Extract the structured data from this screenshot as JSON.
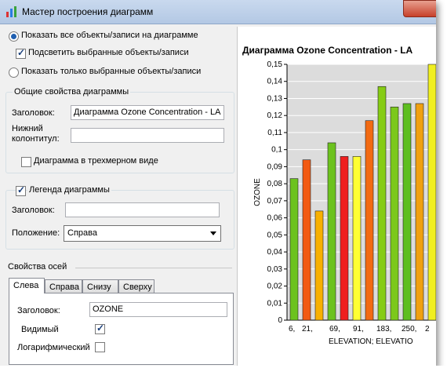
{
  "window": {
    "title": "Мастер построения диаграмм"
  },
  "display": {
    "show_all_label": "Показать все объекты/записи на диаграмме",
    "highlight_selected_label": "Подсветить выбранные объекты/записи",
    "show_selected_only_label": "Показать только выбранные объекты/записи"
  },
  "general": {
    "group_title": "Общие свойства диаграммы",
    "title_label": "Заголовок:",
    "title_value": "Диаграмма  Ozone Concentration - LA",
    "footer_label_1": "Нижний",
    "footer_label_2": "колонтитул:",
    "footer_value": "",
    "three_d_label": "Диаграмма в трехмерном виде"
  },
  "legend": {
    "group_title": "Легенда диаграммы",
    "title_label": "Заголовок:",
    "title_value": "",
    "position_label": "Положение:",
    "position_value": "Справа"
  },
  "axes": {
    "section_title": "Свойства осей",
    "tabs": [
      "Слева",
      "Справа",
      "Снизу",
      "Сверху"
    ],
    "title_label": "Заголовок:",
    "title_value": "OZONE",
    "visible_label": "Видимый",
    "log_label": "Логарифмический"
  },
  "chart_data": {
    "type": "bar",
    "title": "Диаграмма  Ozone Concentration - LA",
    "xlabel": "ELEVATION; ELEVATIO",
    "ylabel": "OZONE",
    "ylim": [
      0,
      0.15
    ],
    "yticks": [
      "0",
      "0,01",
      "0,02",
      "0,03",
      "0,04",
      "0,05",
      "0,06",
      "0,07",
      "0,08",
      "0,09",
      "0,1",
      "0,11",
      "0,12",
      "0,13",
      "0,14",
      "0,15"
    ],
    "xtick_labels": [
      "6,",
      "21,",
      "69,",
      "91,",
      "183,",
      "250,",
      "2"
    ],
    "values": [
      0.083,
      0.094,
      0.064,
      0.104,
      0.096,
      0.096,
      0.117,
      0.137,
      0.125,
      0.127,
      0.127,
      0.15
    ],
    "colors": [
      "#6cc21e",
      "#f25a12",
      "#f8b000",
      "#6cc21e",
      "#ef1f1f",
      "#ffff33",
      "#f26a12",
      "#86cc14",
      "#7cc81c",
      "#5ebe20",
      "#f0a010",
      "#f0ef20"
    ],
    "grid": true
  }
}
